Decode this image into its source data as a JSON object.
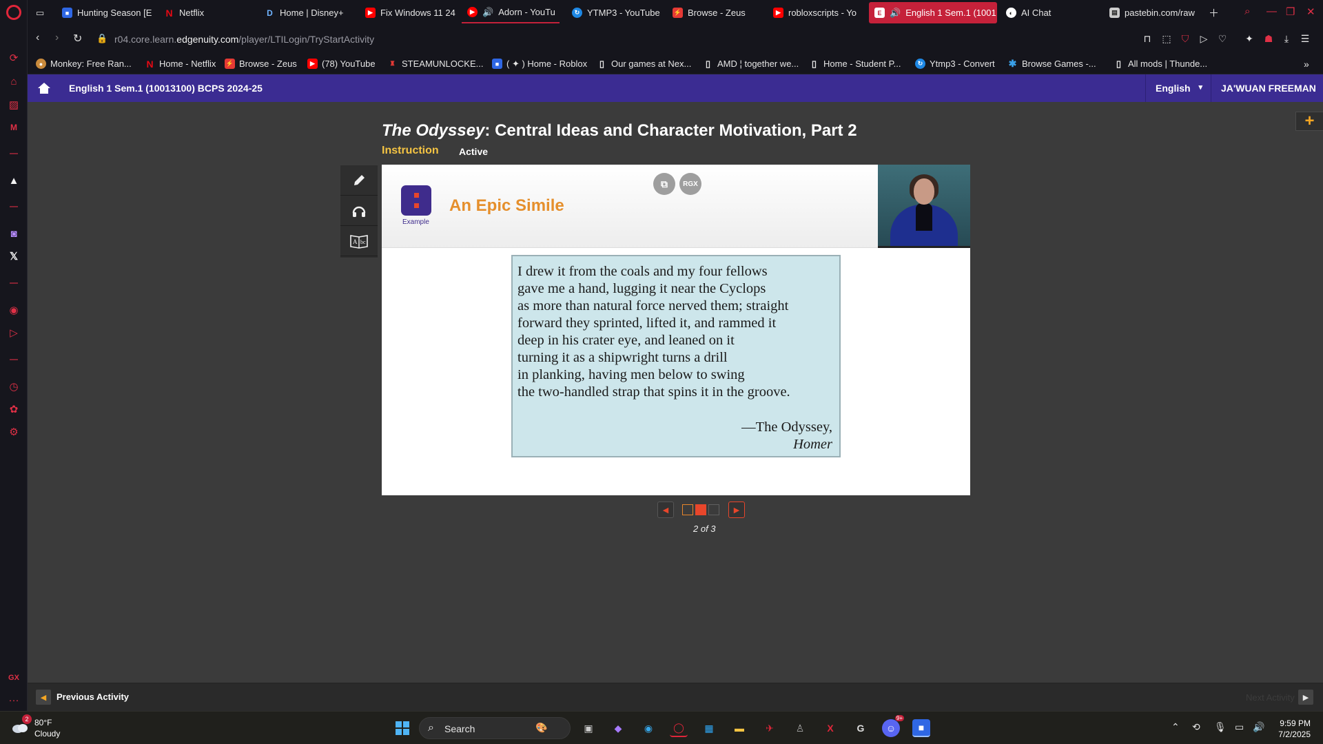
{
  "tabs": [
    {
      "label": "Hunting Season [E",
      "icon": "roblox-icon",
      "color": "#2f67e4"
    },
    {
      "label": "Netflix",
      "icon": "netflix-icon",
      "color": "#e50914"
    },
    {
      "label": "Home | Disney+",
      "icon": "disney-icon",
      "color": "#1f3b70"
    },
    {
      "label": "Fix Windows 11 24",
      "icon": "youtube-icon",
      "color": "#ff0000"
    },
    {
      "label": "Adorn - YouTu",
      "icon": "youtube-icon",
      "color": "#ff0000"
    },
    {
      "label": "YTMP3 - YouTube",
      "icon": "ytmp3-icon",
      "color": "#1e88e5"
    },
    {
      "label": "Browse - Zeus",
      "icon": "zeus-icon",
      "color": "#e53935"
    },
    {
      "label": "robloxscripts - Yo",
      "icon": "youtube-icon",
      "color": "#ff0000"
    },
    {
      "label": "English 1 Sem.1 (1001",
      "icon": "edgenuity-icon",
      "color": "#ffffff"
    },
    {
      "label": "AI Chat",
      "icon": "ai-chat-icon",
      "color": "#ffffff"
    },
    {
      "label": "pastebin.com/raw",
      "icon": "pastebin-icon",
      "color": "#cccccc"
    }
  ],
  "address": {
    "url_prefix": "r04.core.learn.",
    "url_domain": "edgenuity.com",
    "url_path": "/player/LTILogin/TryStartActivity"
  },
  "bookmarks": [
    {
      "label": "Monkey: Free Ran...",
      "icon": "monkey-icon",
      "color": "#c98a3c"
    },
    {
      "label": "Home - Netflix",
      "icon": "netflix-icon",
      "color": "#e50914"
    },
    {
      "label": "Browse - Zeus",
      "icon": "zeus-icon",
      "color": "#e53935"
    },
    {
      "label": "(78) YouTube",
      "icon": "youtube-icon",
      "color": "#ff0000"
    },
    {
      "label": "STEAMUNLOCKE...",
      "icon": "steamunlocked-icon",
      "color": "#e53935"
    },
    {
      "label": "( ✦ ) Home - Roblox",
      "icon": "roblox-icon",
      "color": "#2f67e4"
    },
    {
      "label": "Our games at Nex...",
      "icon": "page-icon",
      "color": "#e6e6e6"
    },
    {
      "label": "AMD ¦ together we...",
      "icon": "page-icon",
      "color": "#e6e6e6"
    },
    {
      "label": "Home - Student P...",
      "icon": "page-icon",
      "color": "#e6e6e6"
    },
    {
      "label": "Ytmp3 - Convert",
      "icon": "ytmp3-icon",
      "color": "#1e88e5"
    },
    {
      "label": "Browse Games -...",
      "icon": "gear-icon",
      "color": "#3aa0e8"
    },
    {
      "label": "All mods | Thunde...",
      "icon": "page-icon",
      "color": "#e6e6e6"
    }
  ],
  "header": {
    "course": "English 1 Sem.1 (10013100) BCPS 2024-25",
    "language": "English",
    "user": "JA'WUAN FREEMAN"
  },
  "lesson": {
    "title_italic": "The Odyssey",
    "title_rest": ": Central Ideas and Character Motivation, Part 2",
    "type": "Instruction",
    "status": "Active"
  },
  "slide": {
    "badge_label": "Example",
    "heading": "An Epic Simile",
    "rgx_label": "RGX",
    "quote_lines": [
      "I drew it from the coals and my four fellows",
      "gave me a hand, lugging it near the Cyclops",
      "as more than natural force nerved them; straight",
      "forward they sprinted, lifted it, and rammed it",
      "deep in his crater eye, and leaned on it",
      "turning it as a shipwright turns a drill",
      "in planking, having men below to swing",
      "the two-handled strap that spins it in the groove."
    ],
    "attribution_1": "—The Odyssey,",
    "attribution_2": "Homer"
  },
  "pager": {
    "label": "2 of 3",
    "current": 2,
    "total": 3
  },
  "footer": {
    "prev": "Previous Activity",
    "next": "Next Activity"
  },
  "taskbar": {
    "weather_temp": "80°F",
    "weather_desc": "Cloudy",
    "weather_badge": "2",
    "search_label": "Search",
    "discord_badge": "9+",
    "time": "9:59 PM",
    "date": "7/2/2025"
  },
  "colors": {
    "accent": "#c5213a",
    "edgenuity_purple": "#3b2c92",
    "orange": "#e58f2c",
    "quote_bg": "#cde6eb"
  }
}
